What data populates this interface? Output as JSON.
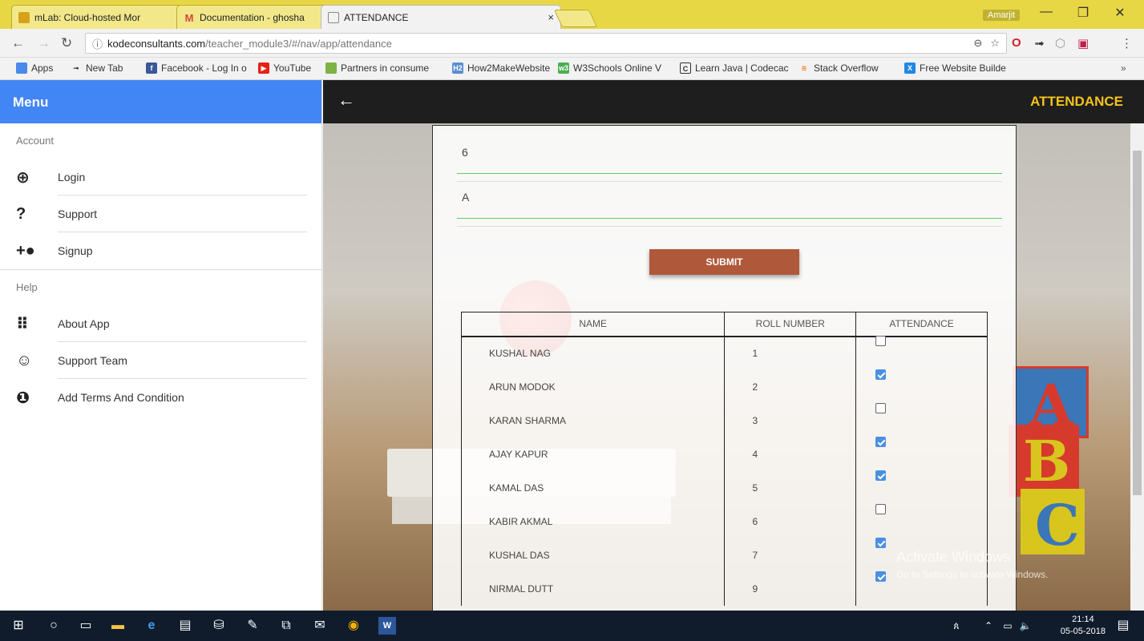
{
  "browser": {
    "tabs": [
      {
        "title": "mLab: Cloud-hosted Mor",
        "color": "#d6a21b"
      },
      {
        "title": "Documentation - ghosha",
        "color": "#d44638"
      },
      {
        "title": "ATTENDANCE",
        "color": "#888888"
      }
    ],
    "profile": "Amarjit",
    "url_host": "kodeconsultants.com",
    "url_path": "/teacher_module3/#/nav/app/attendance",
    "bookmarks": [
      "Apps",
      "New Tab",
      "Facebook - Log In o",
      "YouTube",
      "Partners in consume",
      "How2MakeWebsite",
      "W3Schools Online V",
      "Learn Java | Codecac",
      "Stack Overflow",
      "Free Website Builde"
    ]
  },
  "sidebar": {
    "title": "Menu",
    "account_label": "Account",
    "help_label": "Help",
    "account_items": [
      {
        "label": "Login",
        "icon": "login-icon"
      },
      {
        "label": "Support",
        "icon": "question-icon"
      },
      {
        "label": "Signup",
        "icon": "add-person-icon"
      }
    ],
    "help_items": [
      {
        "label": "About App",
        "icon": "apps-grid-icon"
      },
      {
        "label": "Support Team",
        "icon": "smiley-icon"
      },
      {
        "label": "Add Terms And Condition",
        "icon": "info-icon"
      }
    ]
  },
  "page": {
    "heading": "ATTENDANCE",
    "field1_value": "6",
    "field2_value": "A",
    "submit_label": "SUBMIT",
    "columns": [
      "NAME",
      "ROLL NUMBER",
      "ATTENDANCE"
    ],
    "rows": [
      {
        "name": "KUSHAL NAG",
        "roll": "1",
        "present": false
      },
      {
        "name": "ARUN MODOK",
        "roll": "2",
        "present": true
      },
      {
        "name": "KARAN SHARMA",
        "roll": "3",
        "present": false
      },
      {
        "name": "AJAY KAPUR",
        "roll": "4",
        "present": true
      },
      {
        "name": "KAMAL DAS",
        "roll": "5",
        "present": true
      },
      {
        "name": "KABIR AKMAL",
        "roll": "6",
        "present": false
      },
      {
        "name": "KUSHAL DAS",
        "roll": "7",
        "present": true
      },
      {
        "name": "NIRMAL DUTT",
        "roll": "9",
        "present": true
      }
    ]
  },
  "watermark": {
    "title": "Activate Windows",
    "subtitle": "Go to Settings to activate Windows."
  },
  "taskbar": {
    "time": "21:14",
    "date": "05-05-2018"
  }
}
